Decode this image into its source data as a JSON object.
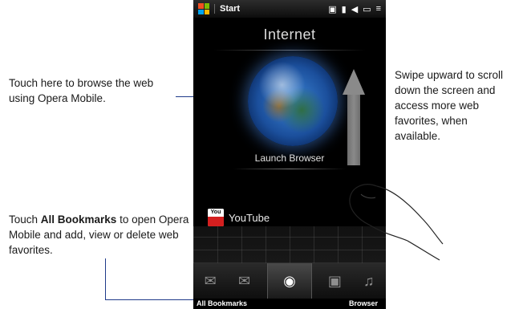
{
  "statusbar": {
    "start_label": "Start",
    "icons": [
      "data-icon",
      "signal-icon",
      "volume-icon",
      "battery-icon",
      "menu-icon"
    ]
  },
  "phone": {
    "title": "Internet",
    "launch_label": "Launch Browser",
    "favorite_label": "YouTube",
    "favorite_icon_text": "You",
    "tabs": [
      "messaging-icon",
      "mail-icon",
      "internet-icon",
      "camera-icon",
      "music-icon"
    ]
  },
  "softkeys": {
    "left": "All Bookmarks",
    "right": "Browser"
  },
  "callouts": {
    "browse": "Touch here to browse the web using Opera Mobile.",
    "swipe": "Swipe upward to scroll down the screen and access more web favorites, when available.",
    "bookmarks_prefix": "Touch ",
    "bookmarks_bold": "All Bookmarks",
    "bookmarks_suffix": " to open Opera Mobile and add, view or delete web favorites."
  },
  "colors": {
    "leader_line": "#1f3a8a",
    "phone_bg": "#000000",
    "youtube_red": "#d41f1f",
    "windows_logo": [
      "#f25022",
      "#7fba00",
      "#00a4ef",
      "#ffb900"
    ]
  }
}
